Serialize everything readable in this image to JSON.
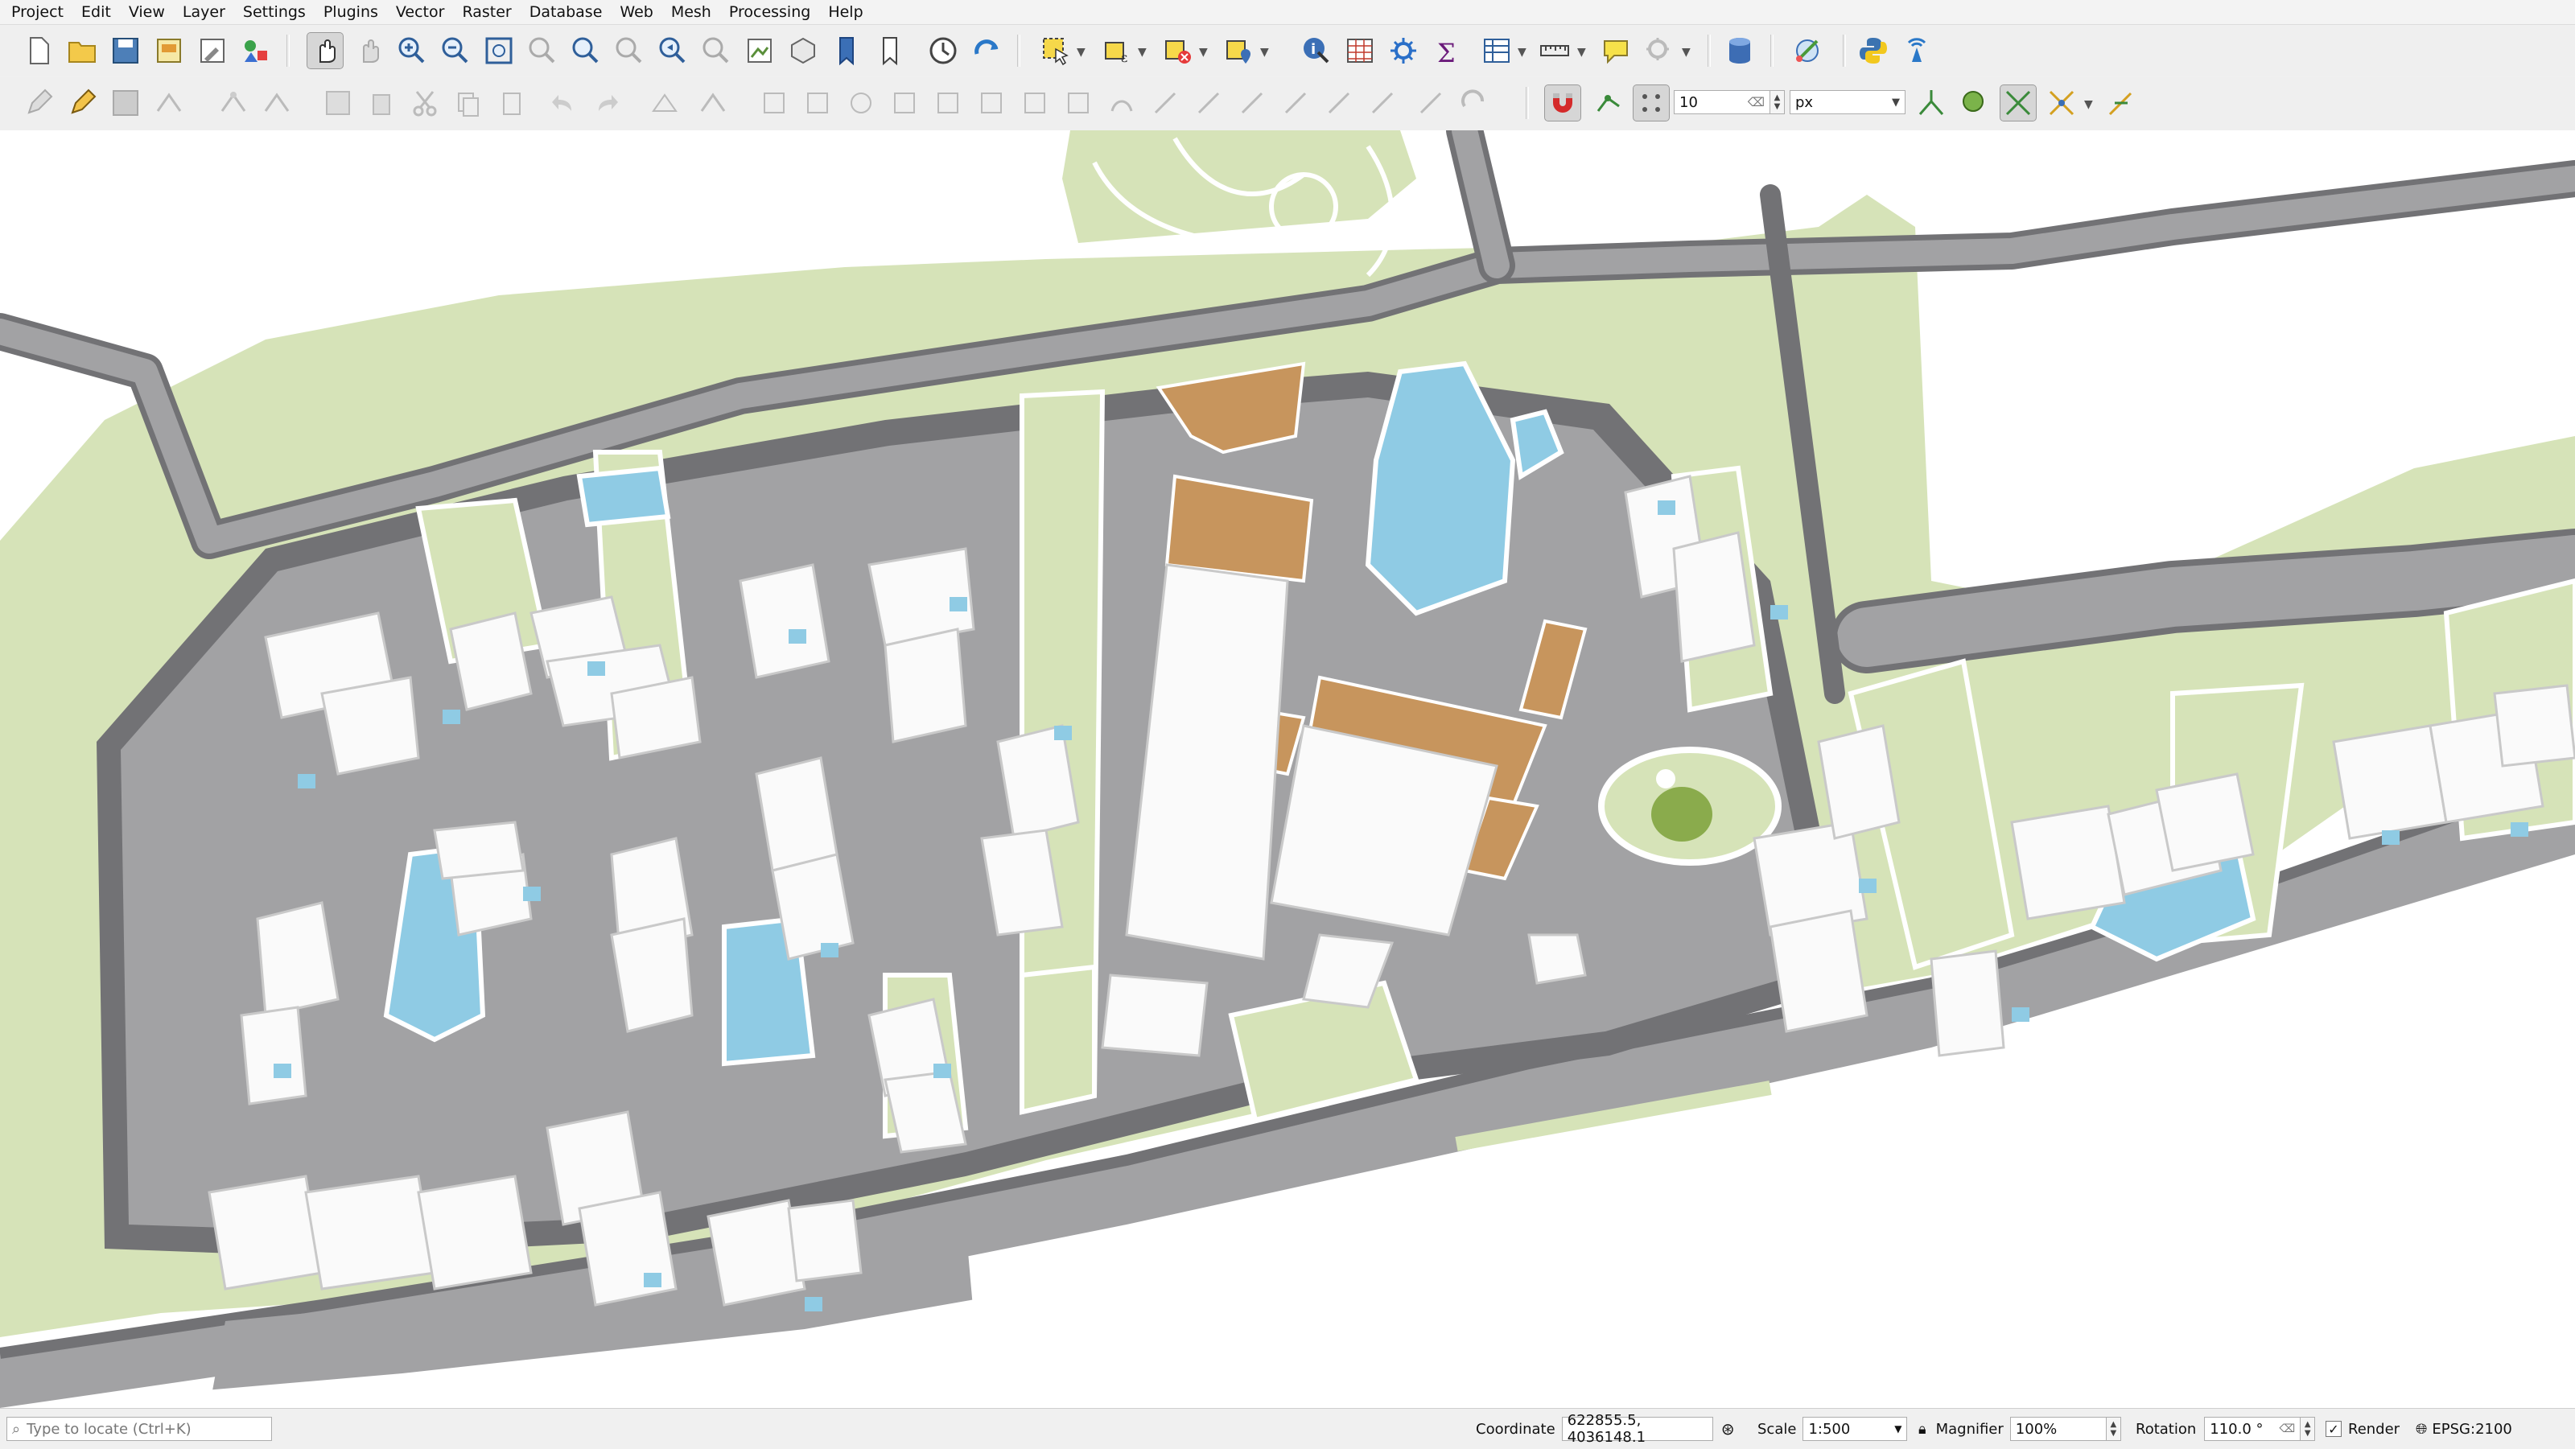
{
  "menu": [
    "Project",
    "Edit",
    "View",
    "Layer",
    "Settings",
    "Plugins",
    "Vector",
    "Raster",
    "Database",
    "Web",
    "Mesh",
    "Processing",
    "Help"
  ],
  "toolbar1": {
    "tools": [
      "new-project",
      "open-project",
      "save-project",
      "new-print-layout",
      "layout-manager",
      "style-manager",
      "pan",
      "pan-to-selection",
      "zoom-in",
      "zoom-out",
      "zoom-full",
      "zoom-to-selection",
      "zoom-to-layer",
      "zoom-to-native",
      "zoom-last",
      "zoom-next",
      "new-map-view",
      "new-3d-view",
      "new-bookmark",
      "show-bookmarks",
      "temporal-controller",
      "refresh",
      "select-features",
      "select-by-expression",
      "deselect",
      "select-by-location",
      "identify",
      "attribute-table",
      "statistics",
      "field-calculator",
      "open-attribute",
      "measure",
      "map-tips",
      "annotation",
      "db-manager",
      "georeferencer",
      "python-console",
      "qgis-web-services"
    ]
  },
  "toolbar2": {
    "snapping_tolerance": "10",
    "snapping_unit": "px"
  },
  "status": {
    "locator_placeholder": "Type to locate (Ctrl+K)",
    "coordinate_label": "Coordinate",
    "coordinate_value": "622855.5, 4036148.1",
    "scale_label": "Scale",
    "scale_value": "1:500",
    "magnifier_label": "Magnifier",
    "magnifier_value": "100%",
    "rotation_label": "Rotation",
    "rotation_value": "110.0 °",
    "render_label": "Render",
    "crs": "EPSG:2100"
  },
  "colors": {
    "land": "#ffffff",
    "road": "#a2a2a4",
    "road_dark": "#727275",
    "grass": "#d6e3b8",
    "building": "#fafafa",
    "water": "#8fcbe4",
    "highlight": "#c7955d",
    "tree": "#8aab4c"
  }
}
